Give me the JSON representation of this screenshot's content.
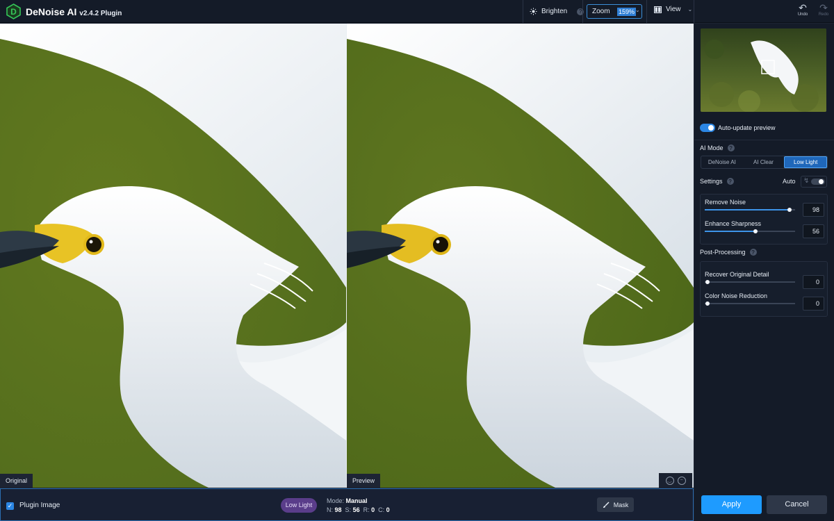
{
  "app": {
    "name": "DeNoise AI",
    "version": "v2.4.2 Plugin"
  },
  "toolbar": {
    "brighten_label": "Brighten",
    "zoom_label": "Zoom",
    "zoom_value": "159%",
    "view_label": "View",
    "undo_label": "Undo",
    "redo_label": "Redo"
  },
  "canvas": {
    "left_label": "Original",
    "right_label": "Preview"
  },
  "bottom": {
    "plugin_image_label": "Plugin Image",
    "plugin_image_checked": true,
    "mode_badge": "Low Light",
    "mode_prefix": "Mode:",
    "mode_value": "Manual",
    "n_label": "N:",
    "n_value": "98",
    "s_label": "S:",
    "s_value": "56",
    "r_label": "R:",
    "r_value": "0",
    "c_label": "C:",
    "c_value": "0",
    "mask_label": "Mask"
  },
  "sidebar": {
    "auto_update_label": "Auto-update preview",
    "auto_update_on": true,
    "ai_mode_label": "AI Mode",
    "ai_modes": [
      "DeNoise AI",
      "AI Clear",
      "Low Light"
    ],
    "ai_mode_selected": "Low Light",
    "settings_label": "Settings",
    "auto_label": "Auto",
    "auto_on": false,
    "remove_noise_label": "Remove Noise",
    "remove_noise_value": "98",
    "enhance_sharpness_label": "Enhance Sharpness",
    "enhance_sharpness_value": "56",
    "post_processing_label": "Post-Processing",
    "recover_detail_label": "Recover Original Detail",
    "recover_detail_value": "0",
    "color_noise_label": "Color Noise Reduction",
    "color_noise_value": "0",
    "apply_label": "Apply",
    "cancel_label": "Cancel"
  },
  "colors": {
    "accent": "#1e9bff",
    "badge_purple": "#5a3d8a",
    "background_green": "#5e7420"
  }
}
